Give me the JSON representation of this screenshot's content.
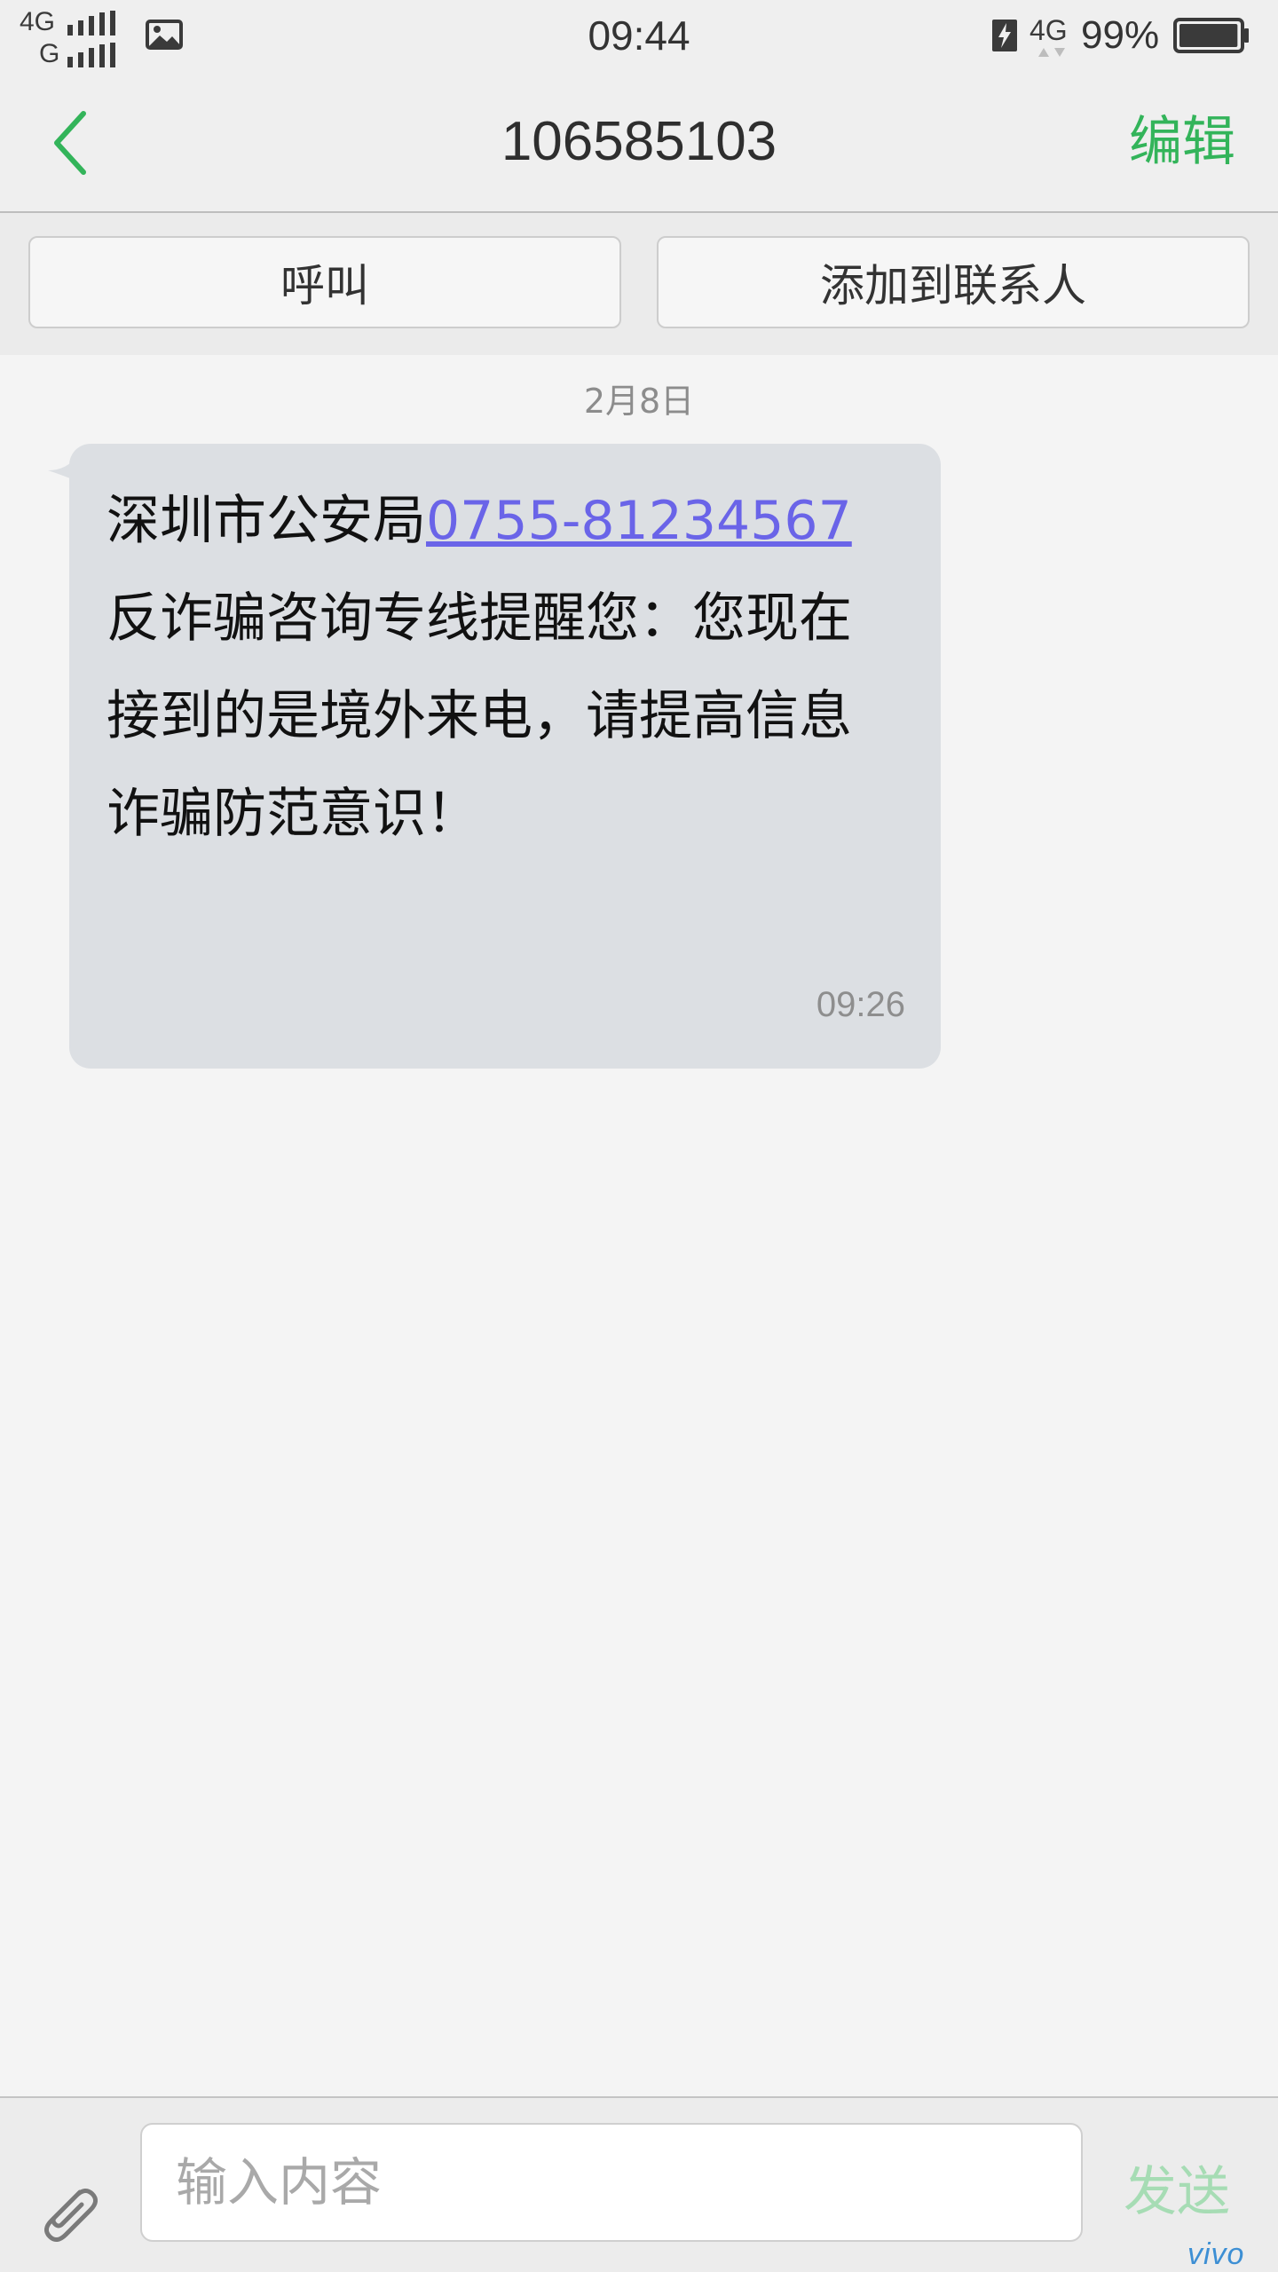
{
  "status_bar": {
    "signal_1_label": "4G",
    "signal_2_label": "G",
    "gallery_icon": "picture-icon",
    "time": "09:44",
    "network_type": "4G",
    "battery_percent": "99%",
    "battery_level": 0.99,
    "charging_icon": "battery-charging-icon"
  },
  "header": {
    "back_icon": "chevron-left-icon",
    "title": "106585103",
    "edit_label": "编辑"
  },
  "actions": {
    "call_label": "呼叫",
    "add_contact_label": "添加到联系人"
  },
  "conversation": {
    "date": "2月8日",
    "message": {
      "text_before_link": "深圳市公安局",
      "link": "0755-81234567",
      "text_after_link": "反诈骗咨询专线提醒您：您现在接到的是境外来电，请提高信息诈骗防范意识！",
      "time": "09:26"
    }
  },
  "compose": {
    "attach_icon": "paperclip-icon",
    "placeholder": "输入内容",
    "value": "",
    "send_label": "发送"
  },
  "brand": "vivo",
  "colors": {
    "accent_green": "#33b45a",
    "send_disabled": "#a6dcb4",
    "link": "#6a64e8",
    "bubble": "#dcdfe3",
    "brand_blue": "#3d8fd4"
  }
}
